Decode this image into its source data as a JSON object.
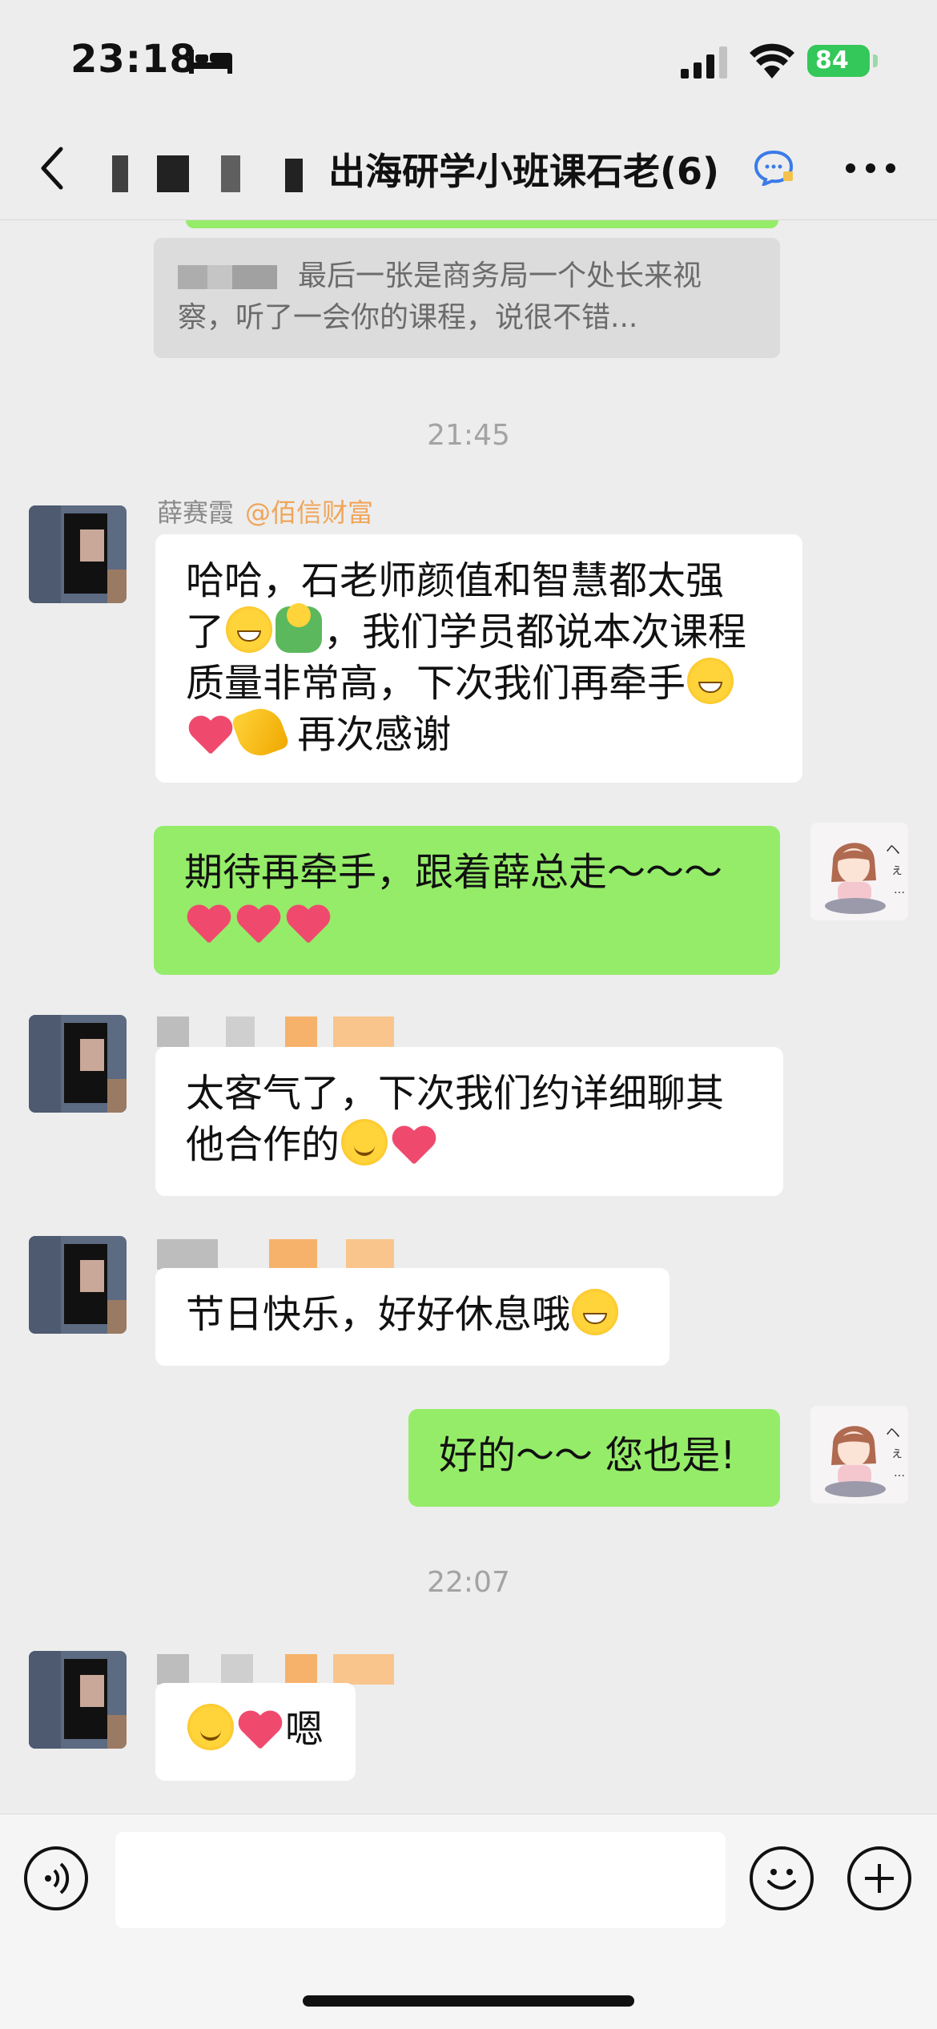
{
  "status_bar": {
    "time": "23:18",
    "battery": "84"
  },
  "header": {
    "title": "出海研学小班课石老(6)"
  },
  "quote": {
    "text": "最后一张是商务局一个处长来视察，听了一会你的课程，说很不错..."
  },
  "timestamps": [
    "21:45",
    "22:07"
  ],
  "messages": [
    {
      "sender": "薛赛霞",
      "org": "@佰信财富",
      "line1": "哈哈，石老师颜值和智慧都太强",
      "line2a": "了",
      "line2b": "，我们学员都说本次课程",
      "line3": "质量非常高，下次我们再牵手",
      "line4": " 再次感谢"
    },
    {
      "line1": "期待再牵手，跟着薛总走～～～"
    },
    {
      "line1": "太客气了，下次我们约详细聊其",
      "line2": "他合作的"
    },
    {
      "line1": "节日快乐，好好休息哦"
    },
    {
      "line1": "好的～～ 您也是!"
    },
    {
      "line1": "嗯"
    }
  ],
  "icons": {
    "back": "chevron-left-icon",
    "more": "more-icon",
    "voice": "voice-icon",
    "emoji": "emoji-icon",
    "plus": "plus-icon"
  },
  "colors": {
    "my_bubble": "#95ec69",
    "their_bubble": "#ffffff",
    "background": "#ededed",
    "org_tag": "#f0a55a"
  }
}
